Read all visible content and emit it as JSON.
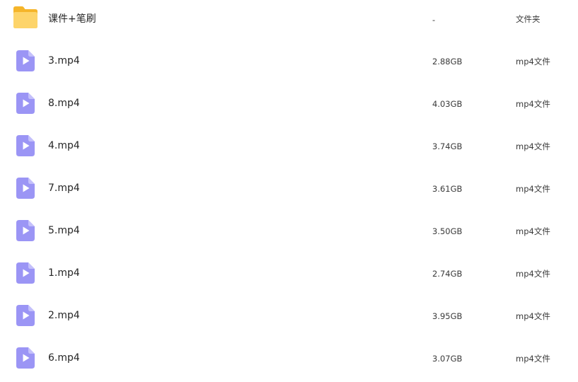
{
  "files": [
    {
      "name": "课件+笔刷",
      "size": "-",
      "type": "文件夹",
      "icon": "folder-icon"
    },
    {
      "name": "3.mp4",
      "size": "2.88GB",
      "type": "mp4文件",
      "icon": "video-file-icon"
    },
    {
      "name": "8.mp4",
      "size": "4.03GB",
      "type": "mp4文件",
      "icon": "video-file-icon"
    },
    {
      "name": "4.mp4",
      "size": "3.74GB",
      "type": "mp4文件",
      "icon": "video-file-icon"
    },
    {
      "name": "7.mp4",
      "size": "3.61GB",
      "type": "mp4文件",
      "icon": "video-file-icon"
    },
    {
      "name": "5.mp4",
      "size": "3.50GB",
      "type": "mp4文件",
      "icon": "video-file-icon"
    },
    {
      "name": "1.mp4",
      "size": "2.74GB",
      "type": "mp4文件",
      "icon": "video-file-icon"
    },
    {
      "name": "2.mp4",
      "size": "3.95GB",
      "type": "mp4文件",
      "icon": "video-file-icon"
    },
    {
      "name": "6.mp4",
      "size": "3.07GB",
      "type": "mp4文件",
      "icon": "video-file-icon"
    }
  ],
  "colors": {
    "folder": "#fcc63f",
    "video": "#9b95f5",
    "text": "#262626"
  }
}
